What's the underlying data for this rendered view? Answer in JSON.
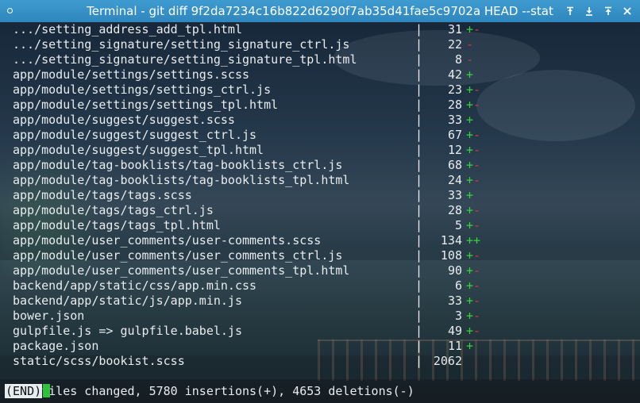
{
  "window": {
    "title": "Terminal - git diff 9f2da7234c16b822d6290f7ab35d41fae5c9702a HEAD --stat",
    "buttons": [
      {
        "name": "pin-icon",
        "glyph": "⚲"
      },
      {
        "name": "minimize-icon",
        "glyph": "⬇"
      },
      {
        "name": "maximize-icon",
        "glyph": "⬆"
      },
      {
        "name": "close-icon",
        "glyph": "✕"
      }
    ]
  },
  "colors": {
    "titlebar": "#3592c8",
    "added": "#39d33a",
    "deleted": "#d33a3a",
    "text": "#e8ecef",
    "cursor": "#2ec23a"
  },
  "diffstat": {
    "separator": "|",
    "files": [
      {
        "name": ".../setting_address_add_tpl.html",
        "count": "31",
        "plus": "+",
        "minus": "-"
      },
      {
        "name": ".../setting_signature/setting_signature_ctrl.js",
        "count": "22",
        "plus": "",
        "minus": "-"
      },
      {
        "name": ".../setting_signature/setting_signature_tpl.html",
        "count": "8",
        "plus": "",
        "minus": "-"
      },
      {
        "name": "app/module/settings/settings.scss",
        "count": "42",
        "plus": "+",
        "minus": ""
      },
      {
        "name": "app/module/settings/settings_ctrl.js",
        "count": "23",
        "plus": "+",
        "minus": "-"
      },
      {
        "name": "app/module/settings/settings_tpl.html",
        "count": "28",
        "plus": "+",
        "minus": "-"
      },
      {
        "name": "app/module/suggest/suggest.scss",
        "count": "33",
        "plus": "+",
        "minus": ""
      },
      {
        "name": "app/module/suggest/suggest_ctrl.js",
        "count": "67",
        "plus": "+",
        "minus": "-"
      },
      {
        "name": "app/module/suggest/suggest_tpl.html",
        "count": "12",
        "plus": "+",
        "minus": "-"
      },
      {
        "name": "app/module/tag-booklists/tag-booklists_ctrl.js",
        "count": "68",
        "plus": "+",
        "minus": "-"
      },
      {
        "name": "app/module/tag-booklists/tag-booklists_tpl.html",
        "count": "24",
        "plus": "+",
        "minus": "-"
      },
      {
        "name": "app/module/tags/tags.scss",
        "count": "33",
        "plus": "+",
        "minus": ""
      },
      {
        "name": "app/module/tags/tags_ctrl.js",
        "count": "28",
        "plus": "+",
        "minus": "-"
      },
      {
        "name": "app/module/tags/tags_tpl.html",
        "count": "5",
        "plus": "+",
        "minus": "-"
      },
      {
        "name": "app/module/user_comments/user-comments.scss",
        "count": "134",
        "plus": "++",
        "minus": ""
      },
      {
        "name": "app/module/user_comments/user_comments_ctrl.js",
        "count": "108",
        "plus": "+",
        "minus": "-"
      },
      {
        "name": "app/module/user_comments/user_comments_tpl.html",
        "count": "90",
        "plus": "+",
        "minus": "-"
      },
      {
        "name": "backend/app/static/css/app.min.css",
        "count": "6",
        "plus": "+",
        "minus": "-"
      },
      {
        "name": "backend/app/static/js/app.min.js",
        "count": "33",
        "plus": "+",
        "minus": "-"
      },
      {
        "name": "bower.json",
        "count": "3",
        "plus": "+",
        "minus": "-"
      },
      {
        "name": "gulpfile.js => gulpfile.babel.js",
        "count": "49",
        "plus": "+",
        "minus": "-"
      },
      {
        "name": "package.json",
        "count": "11",
        "plus": "+",
        "minus": ""
      },
      {
        "name": "static/scss/bookist.scss",
        "count": "2062",
        "plus": "",
        "minus": ""
      }
    ],
    "summary": "121 files changed, 5780 insertions(+), 4653 deletions(-)"
  },
  "pager": {
    "end_label": "(END)"
  }
}
